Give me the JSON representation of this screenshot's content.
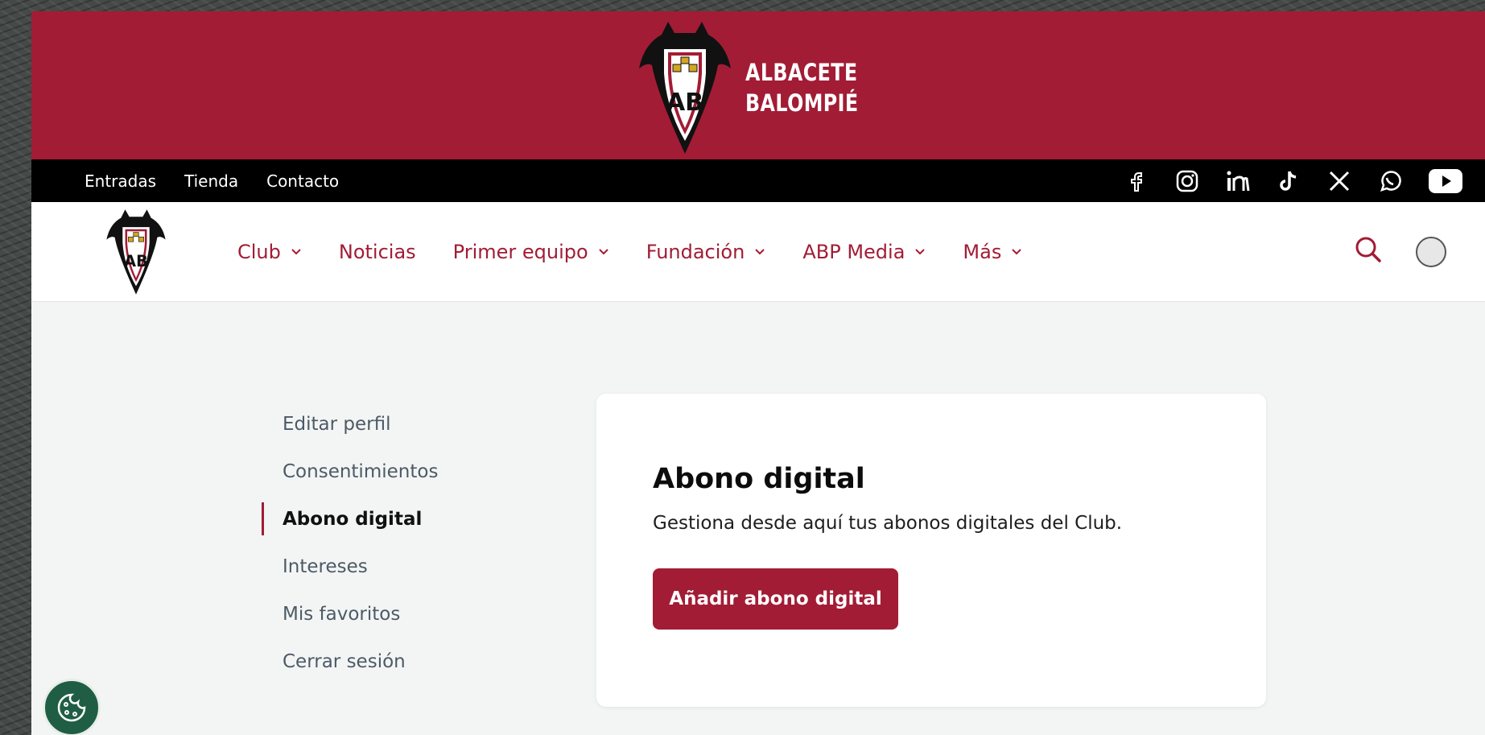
{
  "brand": {
    "wordmark_line1": "ALBACETE",
    "wordmark_line2": "BALOMPIÉ",
    "primary_color": "#a21c35"
  },
  "topbar": {
    "links": [
      "Entradas",
      "Tienda",
      "Contacto"
    ],
    "social_icons": [
      "facebook-icon",
      "instagram-icon",
      "linkedin-icon",
      "tiktok-icon",
      "x-icon",
      "whatsapp-icon",
      "youtube-icon"
    ]
  },
  "mainnav": {
    "items": [
      {
        "label": "Club",
        "dropdown": true
      },
      {
        "label": "Noticias",
        "dropdown": false
      },
      {
        "label": "Primer equipo",
        "dropdown": true
      },
      {
        "label": "Fundación",
        "dropdown": true
      },
      {
        "label": "ABP Media",
        "dropdown": true
      },
      {
        "label": "Más",
        "dropdown": true
      }
    ]
  },
  "sidebar": {
    "items": [
      {
        "label": "Editar perfil",
        "active": false
      },
      {
        "label": "Consentimientos",
        "active": false
      },
      {
        "label": "Abono digital",
        "active": true
      },
      {
        "label": "Intereses",
        "active": false
      },
      {
        "label": "Mis favoritos",
        "active": false
      },
      {
        "label": "Cerrar sesión",
        "active": false
      }
    ]
  },
  "card": {
    "title": "Abono digital",
    "description": "Gestiona desde aquí tus abonos digitales del Club.",
    "button_label": "Añadir abono digital"
  }
}
